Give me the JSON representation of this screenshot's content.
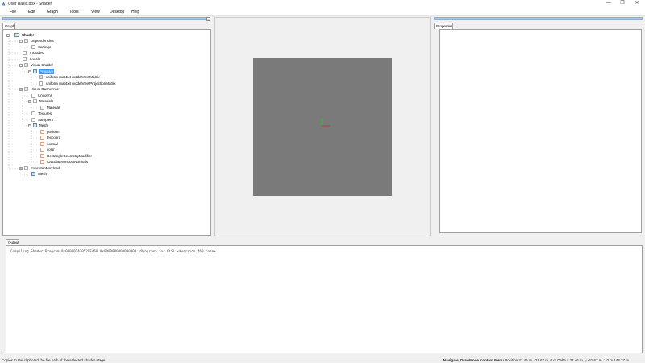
{
  "window": {
    "title": "User Basic.box - Shader",
    "minimize_glyph": "—",
    "maximize_glyph": "❐",
    "close_glyph": "✕"
  },
  "menu": [
    "File",
    "Edit",
    "Graph",
    "Tools",
    "View",
    "Desktop",
    "Help"
  ],
  "graph_panel": {
    "tab_label": "Graph",
    "tree": [
      {
        "label": "Shader",
        "icon": "shader-icon",
        "bold": true
      },
      {
        "label": "Dependencies",
        "icon": "folder-icon"
      },
      {
        "label": "Settings",
        "icon": "settings-icon"
      },
      {
        "label": "Includes",
        "icon": "file-icon"
      },
      {
        "label": "Locals",
        "icon": "file-icon"
      },
      {
        "label": "Visual Shader",
        "icon": "folder-icon"
      },
      {
        "label": "Program",
        "icon": "program-icon",
        "selected": true
      },
      {
        "label": "uniform mat4x4 modelViewMatrix",
        "icon": "uniform-icon"
      },
      {
        "label": "uniform mat4x4 modelViewProjectionMatrix",
        "icon": "uniform-icon"
      },
      {
        "label": "Visual Resources",
        "icon": "folder-icon"
      },
      {
        "label": "Uniforms",
        "icon": "file-icon"
      },
      {
        "label": "Materials",
        "icon": "folder-icon"
      },
      {
        "label": "Material",
        "icon": "material-icon"
      },
      {
        "label": "Textures",
        "icon": "file-icon"
      },
      {
        "label": "Samplers",
        "icon": "file-icon"
      },
      {
        "label": "Mesh",
        "icon": "mesh-icon"
      },
      {
        "label": "position",
        "icon": "attribute-icon"
      },
      {
        "label": "texcoord",
        "icon": "attribute-icon"
      },
      {
        "label": "normal",
        "icon": "attribute-icon"
      },
      {
        "label": "color",
        "icon": "attribute-icon"
      },
      {
        "label": "RectangleGeometryModifier",
        "icon": "modifier-icon"
      },
      {
        "label": "CalculateSmoothNormals",
        "icon": "modifier-icon"
      },
      {
        "label": "Execute Workload",
        "icon": "workload-icon"
      },
      {
        "label": "Mesh",
        "icon": "mesh-icon"
      }
    ]
  },
  "properties_panel": {
    "tab_label": "Properties"
  },
  "output_panel": {
    "tab_label": "Output",
    "text": "Compiling Shader Program 0x000001A70529E460 0x0000000000000000 <Program> for GLSL <#version 460 core>"
  },
  "status": {
    "left": "Copies to the clipboard the file path of the selected shader stage",
    "mode": "Navigate_DrawMode Context Menu",
    "coords": "Position 37.46 m,  -21.67 m,  0 m  Delta x 37.46 m,  y -21.67 m,  z 0 m  143.27 m"
  },
  "colors": {
    "selection": "#3399ff",
    "dock_bar": "#a9c5e0",
    "viewport_bg": "#7a7a7a",
    "axis_x": "#d03030",
    "axis_y": "#30c030"
  }
}
